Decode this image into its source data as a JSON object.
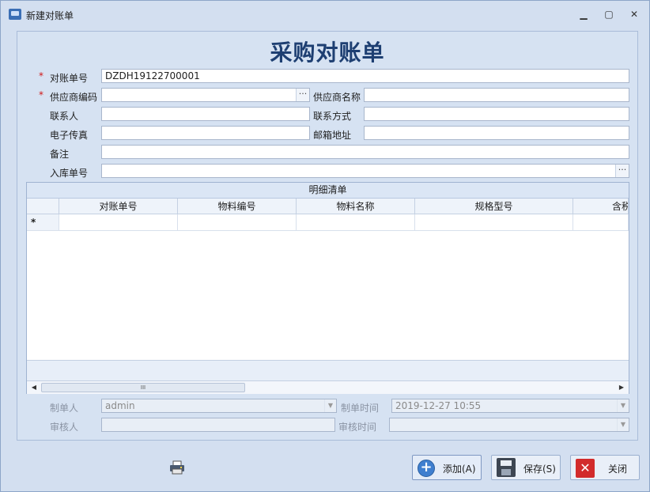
{
  "window": {
    "title": "新建对账单",
    "min_glyph": "▁",
    "max_glyph": "▢",
    "close_glyph": "✕"
  },
  "form": {
    "title": "采购对账单",
    "required_mark": "*",
    "fields": {
      "statement_no": {
        "label": "对账单号",
        "value": "DZDH19122700001"
      },
      "supplier_code": {
        "label": "供应商编码",
        "value": ""
      },
      "supplier_name": {
        "label": "供应商名称",
        "value": ""
      },
      "contact": {
        "label": "联系人",
        "value": ""
      },
      "contact_method": {
        "label": "联系方式",
        "value": ""
      },
      "fax": {
        "label": "电子传真",
        "value": ""
      },
      "email": {
        "label": "邮箱地址",
        "value": ""
      },
      "remark": {
        "label": "备注",
        "value": ""
      },
      "warehouse_no": {
        "label": "入库单号",
        "value": ""
      }
    },
    "ellipsis": "···"
  },
  "grid": {
    "caption": "明细清单",
    "columns": [
      "对账单号",
      "物料编号",
      "物料名称",
      "规格型号",
      "含税"
    ],
    "new_row_marker": "*",
    "scroll_left": "◀",
    "scroll_right": "▶",
    "thumb_grip": "III"
  },
  "meta": {
    "creator": {
      "label": "制单人",
      "value": "admin"
    },
    "create_time": {
      "label": "制单时间",
      "value": "2019-12-27 10:55"
    },
    "reviewer": {
      "label": "审核人",
      "value": ""
    },
    "review_time": {
      "label": "审核时间",
      "value": ""
    },
    "dropdown_glyph": "▼"
  },
  "buttons": {
    "add": {
      "label": "添加(A)",
      "icon": "plus-circle-icon"
    },
    "save": {
      "label": "保存(S)",
      "icon": "floppy-disk-icon"
    },
    "close": {
      "label": "关闭",
      "icon": "close-x-icon"
    }
  },
  "colors": {
    "title": "#1e3f72",
    "required": "#d01515",
    "accent": "#3f7fcf"
  }
}
